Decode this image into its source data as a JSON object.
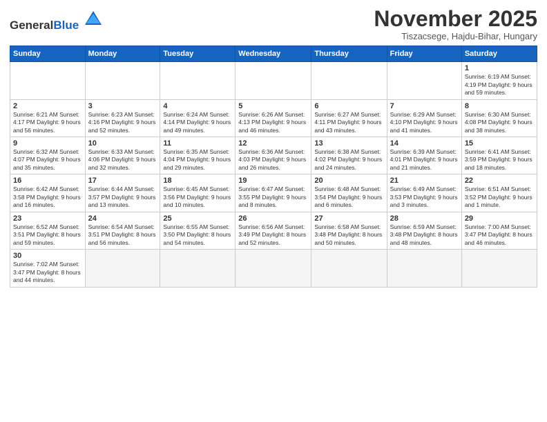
{
  "logo": {
    "text_general": "General",
    "text_blue": "Blue"
  },
  "header": {
    "title": "November 2025",
    "subtitle": "Tiszacsege, Hajdu-Bihar, Hungary"
  },
  "weekdays": [
    "Sunday",
    "Monday",
    "Tuesday",
    "Wednesday",
    "Thursday",
    "Friday",
    "Saturday"
  ],
  "weeks": [
    [
      {
        "day": "",
        "info": ""
      },
      {
        "day": "",
        "info": ""
      },
      {
        "day": "",
        "info": ""
      },
      {
        "day": "",
        "info": ""
      },
      {
        "day": "",
        "info": ""
      },
      {
        "day": "",
        "info": ""
      },
      {
        "day": "1",
        "info": "Sunrise: 6:19 AM\nSunset: 4:19 PM\nDaylight: 9 hours\nand 59 minutes."
      }
    ],
    [
      {
        "day": "2",
        "info": "Sunrise: 6:21 AM\nSunset: 4:17 PM\nDaylight: 9 hours\nand 56 minutes."
      },
      {
        "day": "3",
        "info": "Sunrise: 6:23 AM\nSunset: 4:16 PM\nDaylight: 9 hours\nand 52 minutes."
      },
      {
        "day": "4",
        "info": "Sunrise: 6:24 AM\nSunset: 4:14 PM\nDaylight: 9 hours\nand 49 minutes."
      },
      {
        "day": "5",
        "info": "Sunrise: 6:26 AM\nSunset: 4:13 PM\nDaylight: 9 hours\nand 46 minutes."
      },
      {
        "day": "6",
        "info": "Sunrise: 6:27 AM\nSunset: 4:11 PM\nDaylight: 9 hours\nand 43 minutes."
      },
      {
        "day": "7",
        "info": "Sunrise: 6:29 AM\nSunset: 4:10 PM\nDaylight: 9 hours\nand 41 minutes."
      },
      {
        "day": "8",
        "info": "Sunrise: 6:30 AM\nSunset: 4:08 PM\nDaylight: 9 hours\nand 38 minutes."
      }
    ],
    [
      {
        "day": "9",
        "info": "Sunrise: 6:32 AM\nSunset: 4:07 PM\nDaylight: 9 hours\nand 35 minutes."
      },
      {
        "day": "10",
        "info": "Sunrise: 6:33 AM\nSunset: 4:06 PM\nDaylight: 9 hours\nand 32 minutes."
      },
      {
        "day": "11",
        "info": "Sunrise: 6:35 AM\nSunset: 4:04 PM\nDaylight: 9 hours\nand 29 minutes."
      },
      {
        "day": "12",
        "info": "Sunrise: 6:36 AM\nSunset: 4:03 PM\nDaylight: 9 hours\nand 26 minutes."
      },
      {
        "day": "13",
        "info": "Sunrise: 6:38 AM\nSunset: 4:02 PM\nDaylight: 9 hours\nand 24 minutes."
      },
      {
        "day": "14",
        "info": "Sunrise: 6:39 AM\nSunset: 4:01 PM\nDaylight: 9 hours\nand 21 minutes."
      },
      {
        "day": "15",
        "info": "Sunrise: 6:41 AM\nSunset: 3:59 PM\nDaylight: 9 hours\nand 18 minutes."
      }
    ],
    [
      {
        "day": "16",
        "info": "Sunrise: 6:42 AM\nSunset: 3:58 PM\nDaylight: 9 hours\nand 16 minutes."
      },
      {
        "day": "17",
        "info": "Sunrise: 6:44 AM\nSunset: 3:57 PM\nDaylight: 9 hours\nand 13 minutes."
      },
      {
        "day": "18",
        "info": "Sunrise: 6:45 AM\nSunset: 3:56 PM\nDaylight: 9 hours\nand 10 minutes."
      },
      {
        "day": "19",
        "info": "Sunrise: 6:47 AM\nSunset: 3:55 PM\nDaylight: 9 hours\nand 8 minutes."
      },
      {
        "day": "20",
        "info": "Sunrise: 6:48 AM\nSunset: 3:54 PM\nDaylight: 9 hours\nand 6 minutes."
      },
      {
        "day": "21",
        "info": "Sunrise: 6:49 AM\nSunset: 3:53 PM\nDaylight: 9 hours\nand 3 minutes."
      },
      {
        "day": "22",
        "info": "Sunrise: 6:51 AM\nSunset: 3:52 PM\nDaylight: 9 hours\nand 1 minute."
      }
    ],
    [
      {
        "day": "23",
        "info": "Sunrise: 6:52 AM\nSunset: 3:51 PM\nDaylight: 8 hours\nand 59 minutes."
      },
      {
        "day": "24",
        "info": "Sunrise: 6:54 AM\nSunset: 3:51 PM\nDaylight: 8 hours\nand 56 minutes."
      },
      {
        "day": "25",
        "info": "Sunrise: 6:55 AM\nSunset: 3:50 PM\nDaylight: 8 hours\nand 54 minutes."
      },
      {
        "day": "26",
        "info": "Sunrise: 6:56 AM\nSunset: 3:49 PM\nDaylight: 8 hours\nand 52 minutes."
      },
      {
        "day": "27",
        "info": "Sunrise: 6:58 AM\nSunset: 3:48 PM\nDaylight: 8 hours\nand 50 minutes."
      },
      {
        "day": "28",
        "info": "Sunrise: 6:59 AM\nSunset: 3:48 PM\nDaylight: 8 hours\nand 48 minutes."
      },
      {
        "day": "29",
        "info": "Sunrise: 7:00 AM\nSunset: 3:47 PM\nDaylight: 8 hours\nand 46 minutes."
      }
    ],
    [
      {
        "day": "30",
        "info": "Sunrise: 7:02 AM\nSunset: 3:47 PM\nDaylight: 8 hours\nand 44 minutes."
      },
      {
        "day": "",
        "info": ""
      },
      {
        "day": "",
        "info": ""
      },
      {
        "day": "",
        "info": ""
      },
      {
        "day": "",
        "info": ""
      },
      {
        "day": "",
        "info": ""
      },
      {
        "day": "",
        "info": ""
      }
    ]
  ]
}
